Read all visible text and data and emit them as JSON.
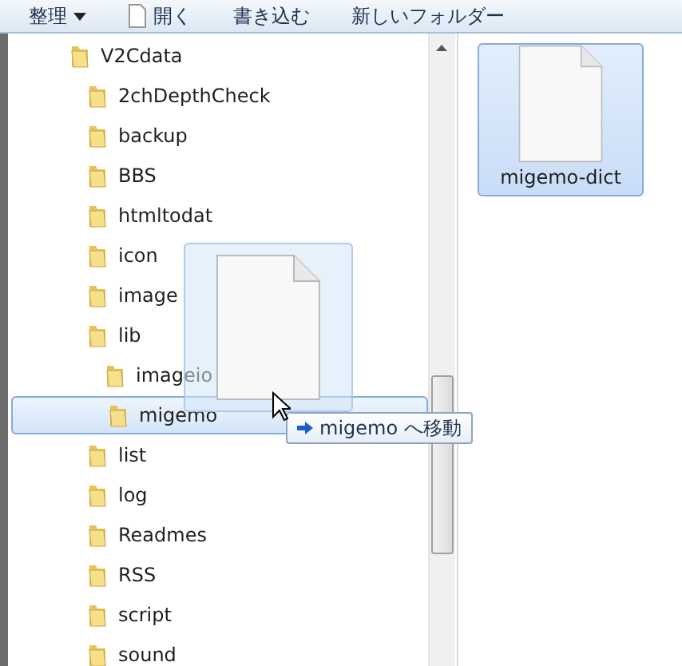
{
  "toolbar": {
    "buttons": [
      {
        "label": "整理",
        "kind": "menu"
      },
      {
        "label": "開く",
        "kind": "open"
      },
      {
        "label": "書き込む",
        "kind": "plain"
      },
      {
        "label": "新しいフォルダー",
        "kind": "plain"
      }
    ]
  },
  "tree": [
    {
      "label": "V2Cdata",
      "selected": false,
      "children": [
        {
          "label": "2chDepthCheck",
          "selected": false
        },
        {
          "label": "backup",
          "selected": false
        },
        {
          "label": "BBS",
          "selected": false
        },
        {
          "label": "htmltodat",
          "selected": false
        },
        {
          "label": "icon",
          "selected": false
        },
        {
          "label": "image",
          "selected": false
        },
        {
          "label": "lib",
          "selected": false,
          "children": [
            {
              "label": "imageio",
              "selected": false
            },
            {
              "label": "migemo",
              "selected": true
            }
          ]
        },
        {
          "label": "list",
          "selected": false
        },
        {
          "label": "log",
          "selected": false
        },
        {
          "label": "Readmes",
          "selected": false
        },
        {
          "label": "RSS",
          "selected": false
        },
        {
          "label": "script",
          "selected": false
        },
        {
          "label": "sound",
          "selected": false
        }
      ]
    }
  ],
  "files": [
    {
      "label": "migemo-dict",
      "selected": true
    }
  ],
  "drag": {
    "tooltip": "migemo へ移動"
  }
}
